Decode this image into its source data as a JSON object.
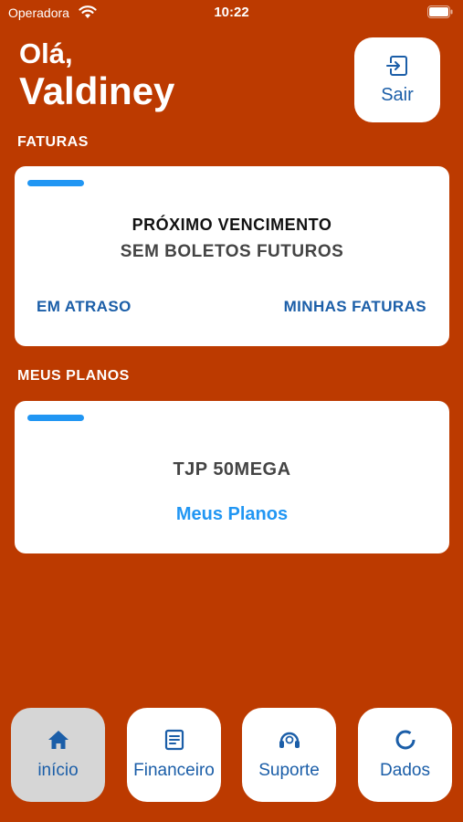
{
  "status_bar": {
    "carrier": "Operadora",
    "time": "10:22"
  },
  "header": {
    "greeting": "Olá,",
    "name": "Valdiney",
    "logout_label": "Sair"
  },
  "invoices": {
    "section_label": "FATURAS",
    "next_due_title": "PRÓXIMO VENCIMENTO",
    "next_due_value": "SEM BOLETOS FUTUROS",
    "overdue_link": "EM ATRASO",
    "my_invoices_link": "MINHAS FATURAS"
  },
  "plans": {
    "section_label": "MEUS PLANOS",
    "plan_name": "TJP 50MEGA",
    "link": "Meus Planos"
  },
  "bottom_nav": {
    "items": [
      {
        "label": "início",
        "icon": "home-icon",
        "active": true
      },
      {
        "label": "Financeiro",
        "icon": "document-icon",
        "active": false
      },
      {
        "label": "Suporte",
        "icon": "support-icon",
        "active": false
      },
      {
        "label": "Dados",
        "icon": "data-icon",
        "active": false
      }
    ]
  },
  "colors": {
    "background": "#BC3A00",
    "accent": "#2196F3",
    "link": "#1B5EA8"
  }
}
